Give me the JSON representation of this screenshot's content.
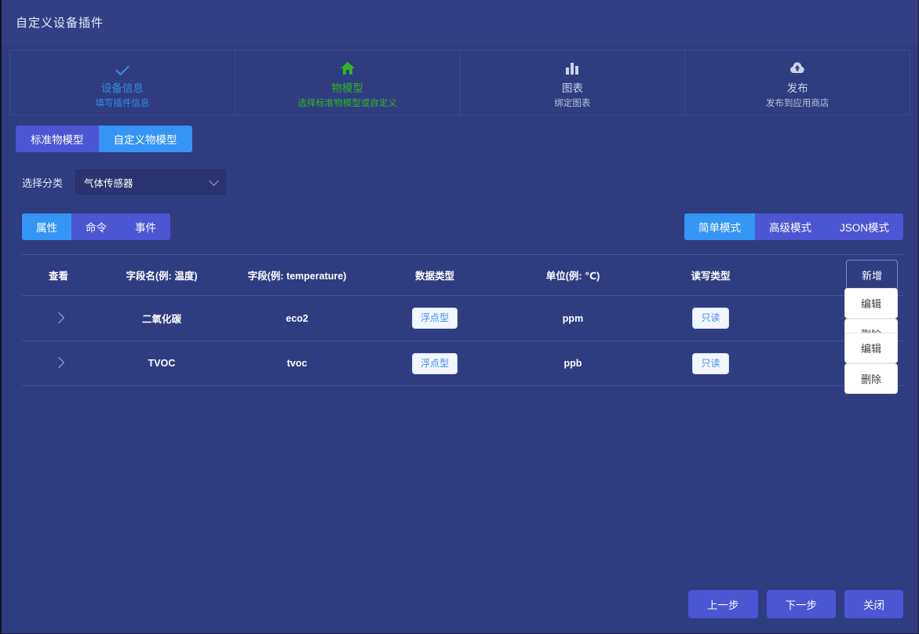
{
  "window": {
    "title": "自定义设备插件"
  },
  "steps": [
    {
      "icon": "check-icon",
      "title": "设备信息",
      "desc": "填写插件信息",
      "state": "done"
    },
    {
      "icon": "home-icon",
      "title": "物模型",
      "desc": "选择标准物模型或自定义",
      "state": "active"
    },
    {
      "icon": "bar-chart-icon",
      "title": "图表",
      "desc": "绑定图表",
      "state": "todo"
    },
    {
      "icon": "cloud-upload-icon",
      "title": "发布",
      "desc": "发布到应用商店",
      "state": "todo"
    }
  ],
  "model_tabs": [
    {
      "label": "标准物模型",
      "selected": true
    },
    {
      "label": "自定义物模型",
      "selected": false
    }
  ],
  "category": {
    "label": "选择分类",
    "value": "气体传感器",
    "chevron": "chevron-down-icon"
  },
  "left_segments": [
    {
      "label": "属性",
      "active": true
    },
    {
      "label": "命令",
      "active": false
    },
    {
      "label": "事件",
      "active": false
    }
  ],
  "right_segments": [
    {
      "label": "简单模式",
      "active": true
    },
    {
      "label": "高级模式",
      "active": false
    },
    {
      "label": "JSON模式",
      "active": false
    }
  ],
  "table": {
    "headers": {
      "view": "查看",
      "name": "字段名(例: 温度)",
      "field": "字段(例: temperature)",
      "datatype": "数据类型",
      "unit": "单位(例: ℃)",
      "rw": "读写类型"
    },
    "add_label": "新增",
    "rows": [
      {
        "expand": "chevron-right-icon",
        "name": "二氧化碳",
        "field": "eco2",
        "datatype": "浮点型",
        "unit": "ppm",
        "rw": "只读",
        "edit": "编辑",
        "delete": "删除"
      },
      {
        "expand": "chevron-right-icon",
        "name": "TVOC",
        "field": "tvoc",
        "datatype": "浮点型",
        "unit": "ppb",
        "rw": "只读",
        "edit": "编辑",
        "delete": "删除"
      }
    ]
  },
  "footer": {
    "prev": "上一步",
    "next": "下一步",
    "close": "关闭"
  },
  "colors": {
    "background": "#2f3c80",
    "header": "#333e85",
    "accent_blue": "#3595f5",
    "accent_purple": "#4a56d2",
    "done": "#2f8fe0",
    "active_green": "#2fb622"
  }
}
